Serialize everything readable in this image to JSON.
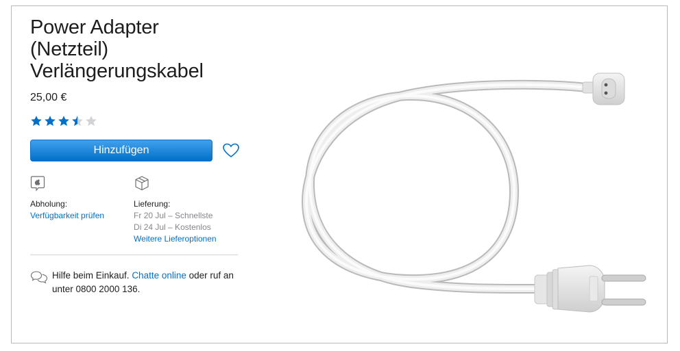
{
  "product": {
    "title_line1": "Power Adapter",
    "title_line2": "(Netzteil)",
    "title_line3": "Verlängerungskabel",
    "price": "25,00 €",
    "rating": 3.5,
    "rating_max": 5,
    "star_color": "#0070c9",
    "star_empty_color": "#d2d2d7"
  },
  "actions": {
    "add_label": "Hinzufügen",
    "favorite_icon": "heart-icon"
  },
  "pickup": {
    "icon": "apple-store-icon",
    "label": "Abholung:",
    "link": "Verfügbarkeit prüfen"
  },
  "delivery": {
    "icon": "box-icon",
    "label": "Lieferung:",
    "option1": "Fr 20 Jul – Schnellste",
    "option2": "Di 24 Jul – Kostenlos",
    "link": "Weitere Lieferoptionen"
  },
  "help": {
    "icon": "chat-bubbles-icon",
    "text_before": "Hilfe beim Einkauf. ",
    "link": "Chatte online",
    "text_after_1": " oder ruf an",
    "text_after_2": "unter 0800 2000 136."
  },
  "colors": {
    "accent": "#0070c9",
    "text": "#1d1d1f",
    "muted": "#86868b"
  }
}
